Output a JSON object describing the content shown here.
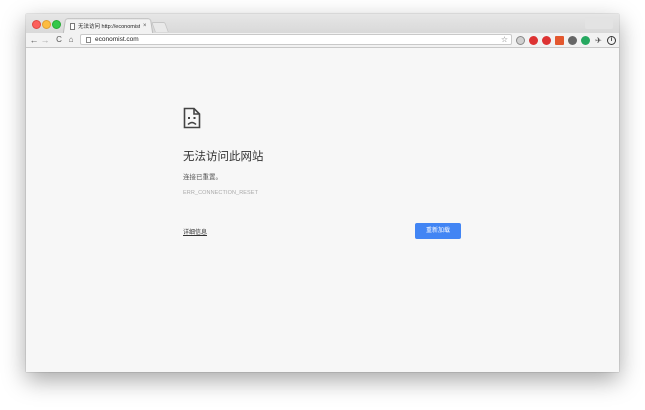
{
  "tab": {
    "title": "无法访问 http://economist.com",
    "close": "×"
  },
  "toolbar": {
    "back": "←",
    "forward": "→",
    "reload": "C",
    "home": "⌂",
    "url": "economist.com",
    "star": "☆"
  },
  "extensions": [
    "search-ext",
    "adblock-ext",
    "abp-ext",
    "bookmark-ext",
    "headphones-ext",
    "grammarly-ext",
    "pin-ext",
    "info-ext",
    "menu"
  ],
  "error": {
    "title": "无法访问此网站",
    "detail": "连接已重置。",
    "code": "ERR_CONNECTION_RESET",
    "details_link": "详细信息",
    "reload_button": "重新加载"
  },
  "colors": {
    "accent": "#4285f4",
    "page_bg": "#f7f7f7"
  }
}
